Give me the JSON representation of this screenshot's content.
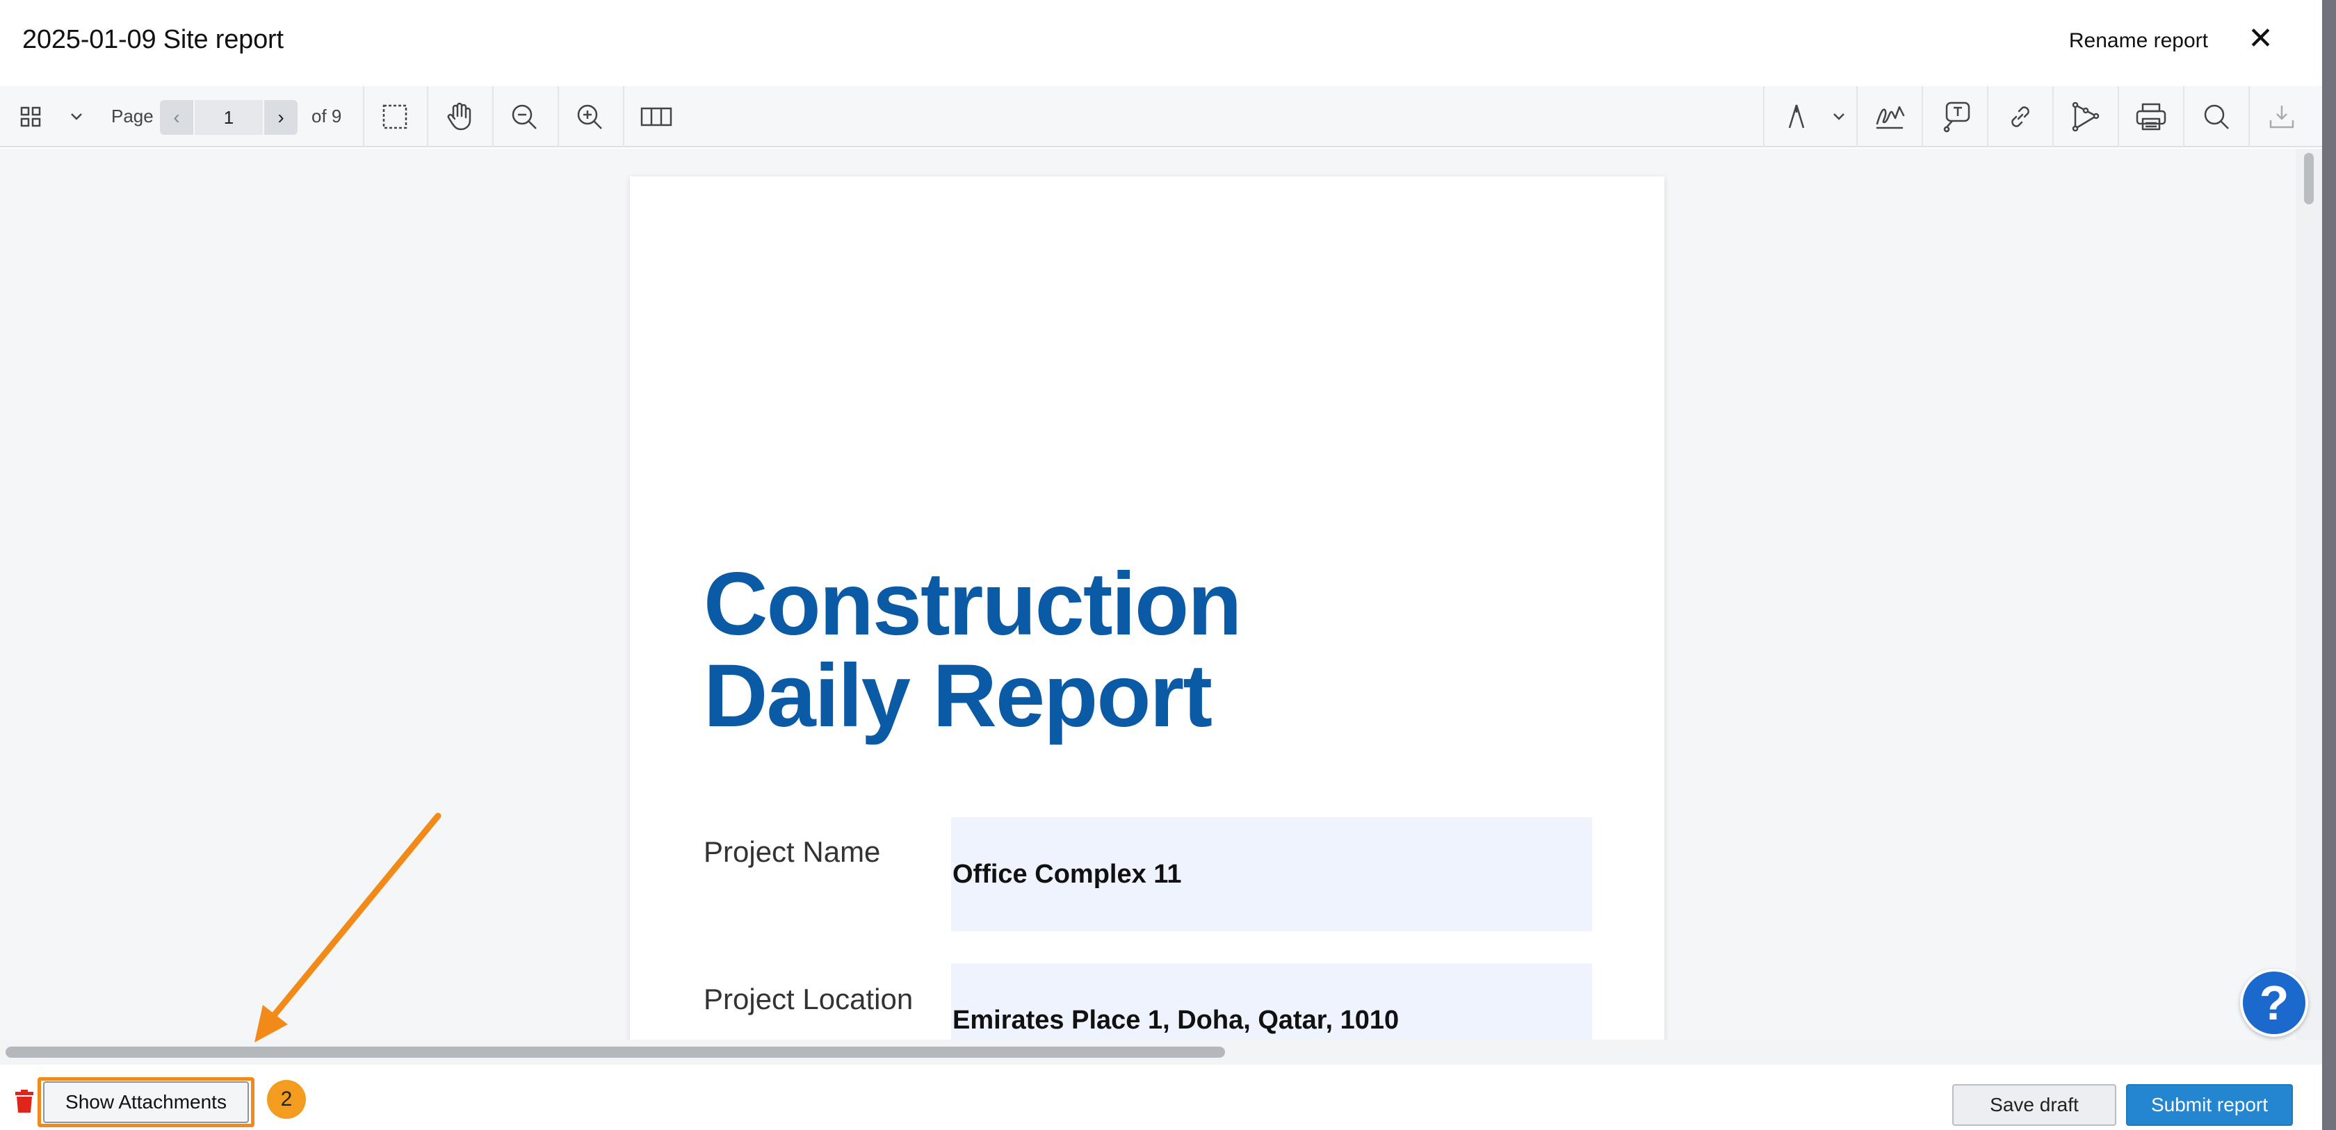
{
  "window": {
    "title": "2025-01-09 Site report",
    "rename_label": "Rename report",
    "close_glyph": "✕"
  },
  "toolbar": {
    "page_label": "Page",
    "prev_glyph": "‹",
    "next_glyph": "›",
    "current_page": "1",
    "of_label": "of 9",
    "left_icons": [
      "grid-view-icon",
      "chevron-down-icon",
      "selection-box-icon",
      "pan-hand-icon",
      "zoom-out-icon",
      "zoom-in-icon",
      "two-page-view-icon"
    ],
    "right_icons": [
      "pen-icon",
      "chevron-down-icon",
      "signature-icon",
      "text-comment-icon",
      "link-icon",
      "shape-tool-icon",
      "print-icon",
      "search-icon",
      "download-icon"
    ]
  },
  "document": {
    "heading_line1": "Construction",
    "heading_line2": "Daily Report",
    "fields": [
      {
        "label": "Project Name",
        "value": "Office Complex 11"
      },
      {
        "label": "Project Location",
        "value": "Emirates Place 1, Doha, Qatar, 1010"
      }
    ]
  },
  "help": {
    "glyph": "?"
  },
  "footer": {
    "attachments_label": "Show Attachments",
    "step_badge": "2",
    "save_draft_label": "Save draft",
    "submit_label": "Submit report"
  },
  "colors": {
    "brand_blue": "#0b5aa6",
    "submit_blue": "#2486d1",
    "highlight_orange": "#f28a1a",
    "delete_red": "#e0251b",
    "field_bg": "#eef3fd"
  }
}
